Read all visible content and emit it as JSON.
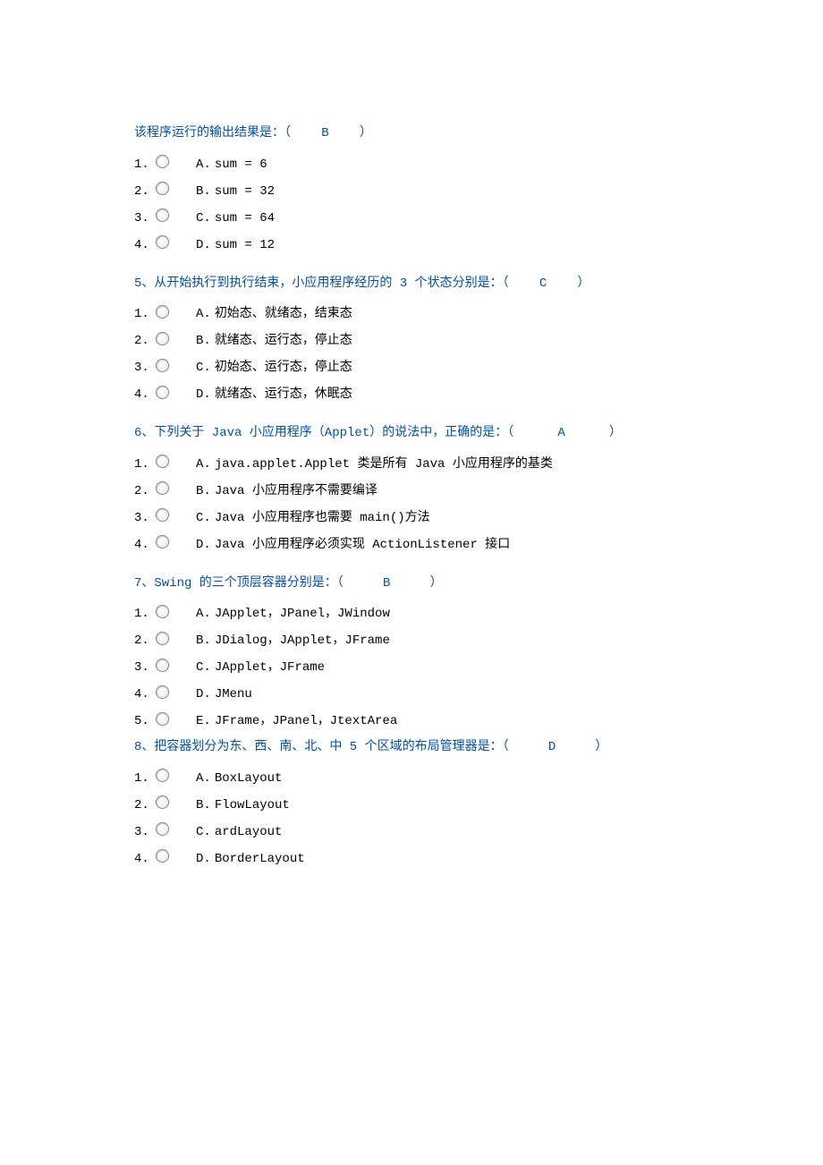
{
  "questions": [
    {
      "title_pre": "该程序运行的输出结果是：（",
      "answer": "B",
      "title_post": "）",
      "options": [
        {
          "n": "1.",
          "l": "A.",
          "t": "sum = 6"
        },
        {
          "n": "2.",
          "l": "B.",
          "t": "sum = 32"
        },
        {
          "n": "3.",
          "l": "C.",
          "t": "sum = 64"
        },
        {
          "n": "4.",
          "l": "D.",
          "t": "sum = 12"
        }
      ]
    },
    {
      "title_pre": "5、从开始执行到执行结束，小应用程序经历的 3 个状态分别是：（",
      "answer": "C",
      "title_post": "）",
      "options": [
        {
          "n": "1.",
          "l": "A.",
          "t": "初始态、就绪态，结束态"
        },
        {
          "n": "2.",
          "l": "B.",
          "t": "就绪态、运行态，停止态"
        },
        {
          "n": "3.",
          "l": "C.",
          "t": "初始态、运行态，停止态"
        },
        {
          "n": "4.",
          "l": "D.",
          "t": "就绪态、运行态，休眠态"
        }
      ]
    },
    {
      "title_pre": "6、下列关于 Java 小应用程序（Applet）的说法中，正确的是：（",
      "answer": "A",
      "title_post": "）",
      "options": [
        {
          "n": "1.",
          "l": "A.",
          "t": "java.applet.Applet 类是所有 Java 小应用程序的基类"
        },
        {
          "n": "2.",
          "l": "B.",
          "t": "Java 小应用程序不需要编译"
        },
        {
          "n": "3.",
          "l": "C.",
          "t": "Java 小应用程序也需要 main()方法"
        },
        {
          "n": "4.",
          "l": "D.",
          "t": "Java 小应用程序必须实现 ActionListener 接口"
        }
      ]
    },
    {
      "title_pre": "7、Swing 的三个顶层容器分别是：（",
      "answer": "B",
      "title_post": "）",
      "tight": true,
      "options": [
        {
          "n": "1.",
          "l": "A.",
          "t": "JApplet，JPanel，JWindow"
        },
        {
          "n": "2.",
          "l": "B.",
          "t": "JDialog，JApplet，JFrame"
        },
        {
          "n": "3.",
          "l": "C.",
          "t": "JApplet，JFrame"
        },
        {
          "n": "4.",
          "l": "D.",
          "t": "JMenu"
        },
        {
          "n": "5.",
          "l": "E.",
          "t": "JFrame，JPanel，JtextArea"
        }
      ]
    },
    {
      "title_pre": "8、把容器划分为东、西、南、北、中 5 个区域的布局管理器是：（",
      "answer": "D",
      "title_post": "）",
      "options": [
        {
          "n": "1.",
          "l": "A.",
          "t": "BoxLayout"
        },
        {
          "n": "2.",
          "l": "B.",
          "t": "FlowLayout"
        },
        {
          "n": "3.",
          "l": "C.",
          "t": "ardLayout"
        },
        {
          "n": "4.",
          "l": "D.",
          "t": "BorderLayout"
        }
      ]
    }
  ]
}
